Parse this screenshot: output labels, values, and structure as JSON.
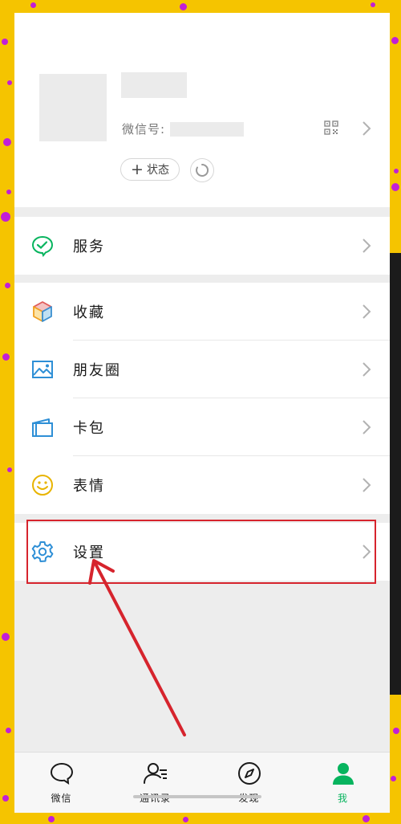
{
  "profile": {
    "wechat_id_label": "微信号:",
    "status_label": "状态"
  },
  "menu": {
    "services": "服务",
    "favorites": "收藏",
    "moments": "朋友圈",
    "cards": "卡包",
    "stickers": "表情",
    "settings": "设置"
  },
  "tabs": [
    {
      "label": "微信"
    },
    {
      "label": "通讯录"
    },
    {
      "label": "发现"
    },
    {
      "label": "我"
    }
  ],
  "colors": {
    "background": "#f5c400",
    "dots": "#c21fd6",
    "highlight": "#d6242d",
    "active_tab": "#07b45e"
  }
}
